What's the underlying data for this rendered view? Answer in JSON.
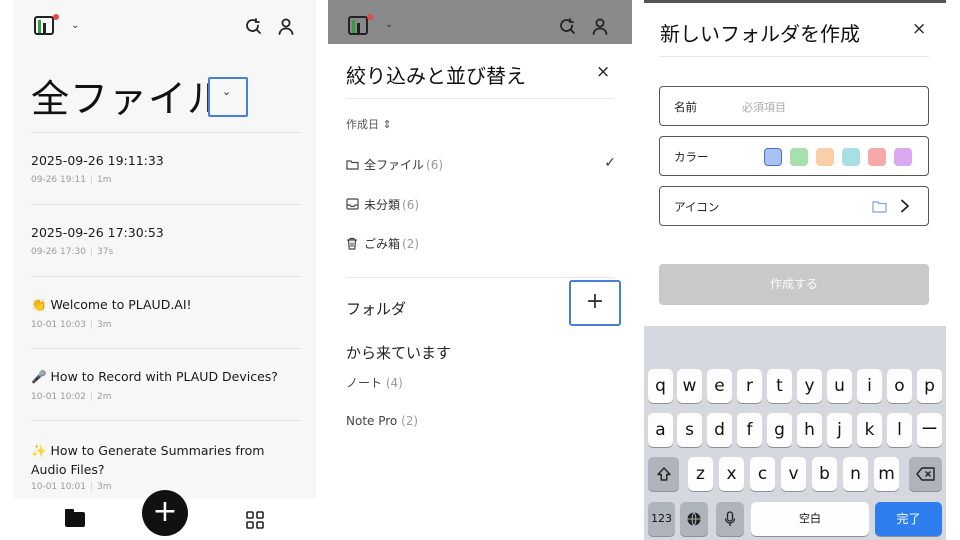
{
  "panel1": {
    "title": "全ファイル",
    "files": [
      {
        "title": "2025-09-26 19:11:33",
        "date": "09-26 19:11",
        "duration": "1m"
      },
      {
        "title": "2025-09-26 17:30:53",
        "date": "09-26 17:30",
        "duration": "37s"
      },
      {
        "title": "👏 Welcome to PLAUD.AI!",
        "date": "10-01 10:03",
        "duration": "3m"
      },
      {
        "title": "🎤 How to Record with PLAUD Devices?",
        "date": "10-01 10:02",
        "duration": "2m"
      },
      {
        "title": "✨ How to Generate Summaries from Audio Files?",
        "date": "10-01 10:01",
        "duration": "3m"
      }
    ],
    "fab_label": "+"
  },
  "panel2": {
    "title": "絞り込みと並び替え",
    "sort_label": "作成日 ⇕",
    "filters": [
      {
        "label": "全ファイル",
        "count": "(6)",
        "icon": "folder-icon",
        "selected": true
      },
      {
        "label": "未分類",
        "count": "(6)",
        "icon": "inbox-icon",
        "selected": false
      },
      {
        "label": "ごみ箱",
        "count": "(2)",
        "icon": "trash-icon",
        "selected": false
      }
    ],
    "folder_heading": "フォルダ",
    "add_label": "+",
    "source_heading": "から来ています",
    "sources": [
      {
        "label": "ノート",
        "count": "(4)"
      },
      {
        "label": "Note Pro",
        "count": "(2)"
      }
    ],
    "close_label": "×"
  },
  "panel3": {
    "title": "新しいフォルダを作成",
    "close_label": "×",
    "name_label": "名前",
    "name_placeholder": "必須項目",
    "color_label": "カラー",
    "colors": [
      "#a9c1f3",
      "#a6e0ad",
      "#f9cfa8",
      "#a8dfe3",
      "#f6a9a9",
      "#dba9f1"
    ],
    "icon_label": "アイコン",
    "create_label": "作成する",
    "keyboard": {
      "row1": [
        "q",
        "w",
        "e",
        "r",
        "t",
        "y",
        "u",
        "i",
        "o",
        "p"
      ],
      "row2": [
        "a",
        "s",
        "d",
        "f",
        "g",
        "h",
        "j",
        "k",
        "l",
        "ー"
      ],
      "row3": [
        "z",
        "x",
        "c",
        "v",
        "b",
        "n",
        "m"
      ],
      "numbers_label": "123",
      "space_label": "空白",
      "done_label": "完了"
    }
  }
}
